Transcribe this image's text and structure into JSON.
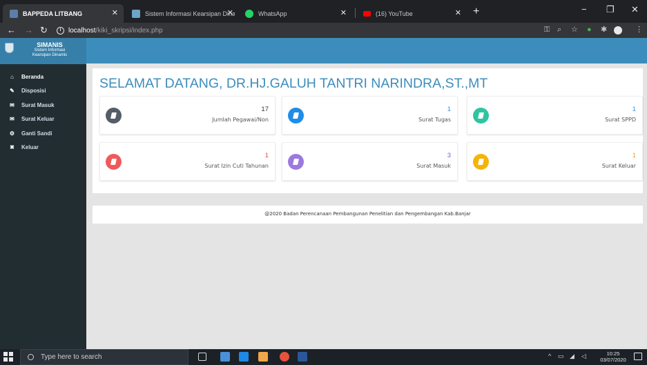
{
  "browser": {
    "tabs": [
      {
        "title": "BAPPEDA LITBANG",
        "favicon_color": "#5b7fa8"
      },
      {
        "title": "Sistem Informasi Kearsipan Dinas",
        "favicon_color": "#6aa6c8"
      },
      {
        "title": "WhatsApp",
        "favicon_color": "#25d366"
      },
      {
        "title": "(16) YouTube",
        "favicon_color": "#ff0000"
      }
    ],
    "url": {
      "host": "localhost",
      "path": "/kiki_skripsi/index.php"
    },
    "new_tab": "+",
    "window_controls": {
      "minimize": "−",
      "maximize": "❐",
      "close": "✕"
    }
  },
  "app": {
    "brand": {
      "title": "SIMANIS",
      "subtitle_line1": "Sistem Informasi",
      "subtitle_line2": "Kearsipan Dinamis"
    },
    "menu": [
      {
        "label": "Beranda",
        "icon": "home-icon",
        "glyph": "⌂"
      },
      {
        "label": "Disposisi",
        "icon": "pencil-icon",
        "glyph": "✎"
      },
      {
        "label": "Surat Masuk",
        "icon": "envelope-icon",
        "glyph": "✉"
      },
      {
        "label": "Surat Keluar",
        "icon": "envelope-icon",
        "glyph": "✉"
      },
      {
        "label": "Ganti Sandi",
        "icon": "gear-icon",
        "glyph": "⚙"
      },
      {
        "label": "Keluar",
        "icon": "close-icon",
        "glyph": "✖"
      }
    ],
    "welcome": "SELAMAT DATANG, DR.HJ.GALUH TANTRI NARINDRA,ST.,MT",
    "cards": [
      {
        "value": "17",
        "label": "Jumlah Pegawai/Non",
        "color": "#555d66",
        "num_color": "#333333"
      },
      {
        "value": "1",
        "label": "Surat Tugas",
        "color": "#1f8de6",
        "num_color": "#3b8ee0"
      },
      {
        "value": "1",
        "label": "Surat SPPD",
        "color": "#2fc4a2",
        "num_color": "#3b8ee0"
      },
      {
        "value": "1",
        "label": "Surat Izin Cuti Tahunan",
        "color": "#ee5a5a",
        "num_color": "#e04848"
      },
      {
        "value": "3",
        "label": "Surat Masuk",
        "color": "#9b79e0",
        "num_color": "#7a5fd0"
      },
      {
        "value": "1",
        "label": "Surat Keluar",
        "color": "#f5b40a",
        "num_color": "#f0a020"
      }
    ],
    "footer": "@2020 Badan Perencanaan Pembangunan Penelitian dan Pengembangan Kab.Banjar"
  },
  "taskbar": {
    "search_placeholder": "Type here to search",
    "clock_time": "10:25",
    "clock_date": "03/07/2020"
  }
}
